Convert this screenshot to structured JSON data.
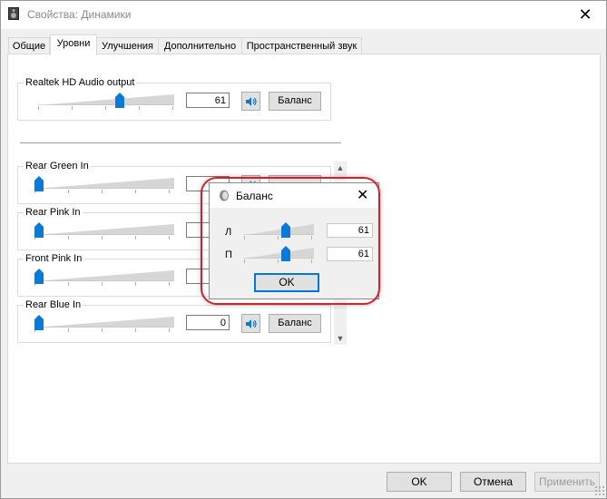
{
  "window": {
    "title": "Свойства: Динамики"
  },
  "tabs": [
    {
      "label": "Общие"
    },
    {
      "label": "Уровни",
      "active": true
    },
    {
      "label": "Улучшения"
    },
    {
      "label": "Дополнительно"
    },
    {
      "label": "Пространственный звук"
    }
  ],
  "master": {
    "label": "Realtek HD Audio output",
    "value": "61",
    "level": 61,
    "balance_label": "Баланс"
  },
  "inputs": [
    {
      "label": "Rear Green In",
      "value": "",
      "level": 0,
      "balance_label": ""
    },
    {
      "label": "Rear Pink In",
      "value": "",
      "level": 0,
      "balance_label": ""
    },
    {
      "label": "Front Pink In",
      "value": "",
      "level": 0,
      "balance_label": ""
    },
    {
      "label": "Rear Blue In",
      "value": "0",
      "level": 0,
      "balance_label": "Баланс"
    }
  ],
  "balance_dialog": {
    "title": "Баланс",
    "left_label": "Л",
    "left_value": "61",
    "left_level": 61,
    "right_label": "П",
    "right_value": "61",
    "right_level": 61,
    "ok_label": "OK"
  },
  "footer": {
    "ok_label": "OK",
    "cancel_label": "Отмена",
    "apply_label": "Применить"
  },
  "colors": {
    "accent": "#0078d7",
    "highlight": "#d71f2a",
    "thumb": "#0a7ad6"
  }
}
